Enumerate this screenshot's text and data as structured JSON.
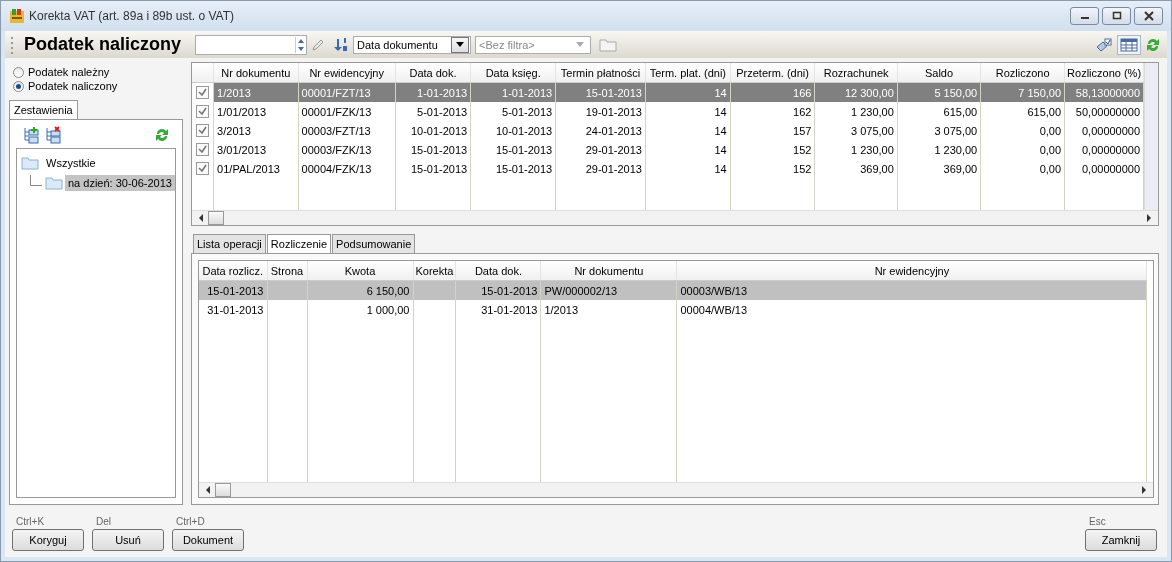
{
  "window": {
    "title": "Korekta VAT (art. 89a i 89b ust. o VAT)"
  },
  "toolbar": {
    "title": "Podatek naliczony",
    "sort": {
      "value": "Data dokumentu"
    },
    "filter": {
      "placeholder": "<Bez filtra>",
      "disabled": true
    }
  },
  "tax_types": [
    {
      "label": "Podatek należny",
      "selected": false
    },
    {
      "label": "Podatek naliczony",
      "selected": true
    }
  ],
  "sidebar": {
    "tabs": [
      {
        "label": "Zestawienia",
        "selected": true
      }
    ],
    "tree": [
      {
        "label": "Wszystkie",
        "selected": false,
        "children": [
          {
            "label": "na dzień: 30-06-2013",
            "selected": true
          }
        ]
      }
    ]
  },
  "documents": {
    "columns": [
      {
        "label": "Nr dokumentu",
        "kind": "text"
      },
      {
        "label": "Nr ewidencyjny",
        "kind": "text"
      },
      {
        "label": "Data dok.",
        "kind": "number"
      },
      {
        "label": "Data księg.",
        "kind": "number"
      },
      {
        "label": "Termin płatności",
        "kind": "number"
      },
      {
        "label": "Term. plat. (dni)",
        "kind": "number"
      },
      {
        "label": "Przeterm. (dni)",
        "kind": "number"
      },
      {
        "label": "Rozrachunek",
        "kind": "number"
      },
      {
        "label": "Saldo",
        "kind": "number"
      },
      {
        "label": "Rozliczono",
        "kind": "number"
      },
      {
        "label": "Rozliczono (%)",
        "kind": "number"
      }
    ],
    "rows": [
      {
        "checked": true,
        "selected": true,
        "cells": [
          "1/2013",
          "00001/FZT/13",
          "1-01-2013",
          "1-01-2013",
          "15-01-2013",
          "14",
          "166",
          "12 300,00",
          "5 150,00",
          "7 150,00",
          "58,13000000"
        ]
      },
      {
        "checked": true,
        "selected": false,
        "cells": [
          "1/01/2013",
          "00001/FZK/13",
          "5-01-2013",
          "5-01-2013",
          "19-01-2013",
          "14",
          "162",
          "1 230,00",
          "615,00",
          "615,00",
          "50,00000000"
        ]
      },
      {
        "checked": true,
        "selected": false,
        "cells": [
          "3/2013",
          "00003/FZT/13",
          "10-01-2013",
          "10-01-2013",
          "24-01-2013",
          "14",
          "157",
          "3 075,00",
          "3 075,00",
          "0,00",
          "0,00000000"
        ]
      },
      {
        "checked": true,
        "selected": false,
        "cells": [
          "3/01/2013",
          "00003/FZK/13",
          "15-01-2013",
          "15-01-2013",
          "29-01-2013",
          "14",
          "152",
          "1 230,00",
          "1 230,00",
          "0,00",
          "0,00000000"
        ]
      },
      {
        "checked": true,
        "selected": false,
        "cells": [
          "01/PAL/2013",
          "00004/FZK/13",
          "15-01-2013",
          "15-01-2013",
          "29-01-2013",
          "14",
          "152",
          "369,00",
          "369,00",
          "0,00",
          "0,00000000"
        ]
      }
    ]
  },
  "detail_tabs": [
    {
      "label": "Lista operacji",
      "selected": false
    },
    {
      "label": "Rozliczenie",
      "selected": true
    },
    {
      "label": "Podsumowanie",
      "selected": false
    }
  ],
  "settlements": {
    "columns": [
      {
        "label": "Data rozlicz.",
        "kind": "number"
      },
      {
        "label": "Strona",
        "kind": "text"
      },
      {
        "label": "Kwota",
        "kind": "number"
      },
      {
        "label": "Korekta",
        "kind": "text"
      },
      {
        "label": "Data dok.",
        "kind": "number"
      },
      {
        "label": "Nr dokumentu",
        "kind": "text"
      },
      {
        "label": "Nr ewidencyjny",
        "kind": "text"
      }
    ],
    "rows": [
      {
        "selected": true,
        "cells": [
          "15-01-2013",
          "",
          "6 150,00",
          "",
          "15-01-2013",
          "PW/000002/13",
          "00003/WB/13"
        ]
      },
      {
        "selected": false,
        "cells": [
          "31-01-2013",
          "",
          "1 000,00",
          "",
          "31-01-2013",
          "1/2013",
          "00004/WB/13"
        ]
      }
    ]
  },
  "actions": [
    {
      "shortcut": "Ctrl+K",
      "label": "Koryguj"
    },
    {
      "shortcut": "Del",
      "label": "Usuń"
    },
    {
      "shortcut": "Ctrl+D",
      "label": "Dokument"
    }
  ],
  "close_action": {
    "shortcut": "Esc",
    "label": "Zamknij"
  }
}
